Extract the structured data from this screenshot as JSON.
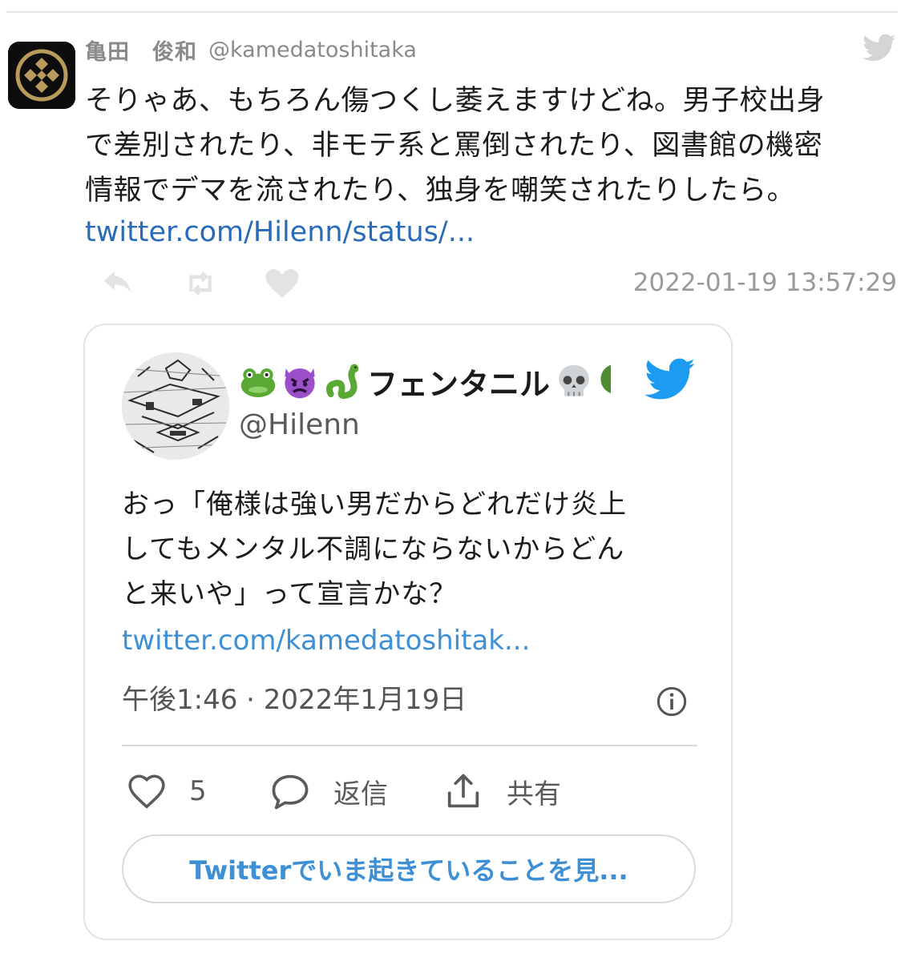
{
  "tweet": {
    "author_name": "亀田　俊和",
    "author_handle": "@kamedatoshitaka",
    "text_lines": [
      "そりゃあ、もちろん傷つくし萎えますけどね。男子校出身",
      "で差別されたり、非モテ系と罵倒されたり、図書館の機密",
      "情報でデマを流されたり、独身を嘲笑されたりしたら。"
    ],
    "link": "twitter.com/Hilenn/status/...",
    "timestamp": "2022-01-19 13:57:29",
    "icons": [
      "reply-icon",
      "retweet-icon",
      "like-icon",
      "twitter-bird-icon"
    ]
  },
  "embed": {
    "display_name": "フェンタニル",
    "name_emojis": [
      "frog-emoji",
      "angry-devil-emoji",
      "snake-emoji"
    ],
    "trailing_emojis": [
      "skull-emoji",
      "tree-emoji"
    ],
    "handle": "@Hilenn",
    "text_lines": [
      "おっ「俺様は強い男だからどれだけ炎上",
      "してもメンタル不調にならないからどん",
      "と来いや」って宣言かな？"
    ],
    "link": "twitter.com/kamedatoshitak...",
    "date": "午後1:46 · 2022年1月19日",
    "like_count": "5",
    "reply_label": "返信",
    "share_label": "共有",
    "cta_label": "Twitterでいま起きていることを見..."
  },
  "colors": {
    "link_outer": "#2a6bb8",
    "link_embed": "#3d8fd6",
    "twitter_blue": "#1d9bf0",
    "muted_text": "#9a9a9a"
  }
}
